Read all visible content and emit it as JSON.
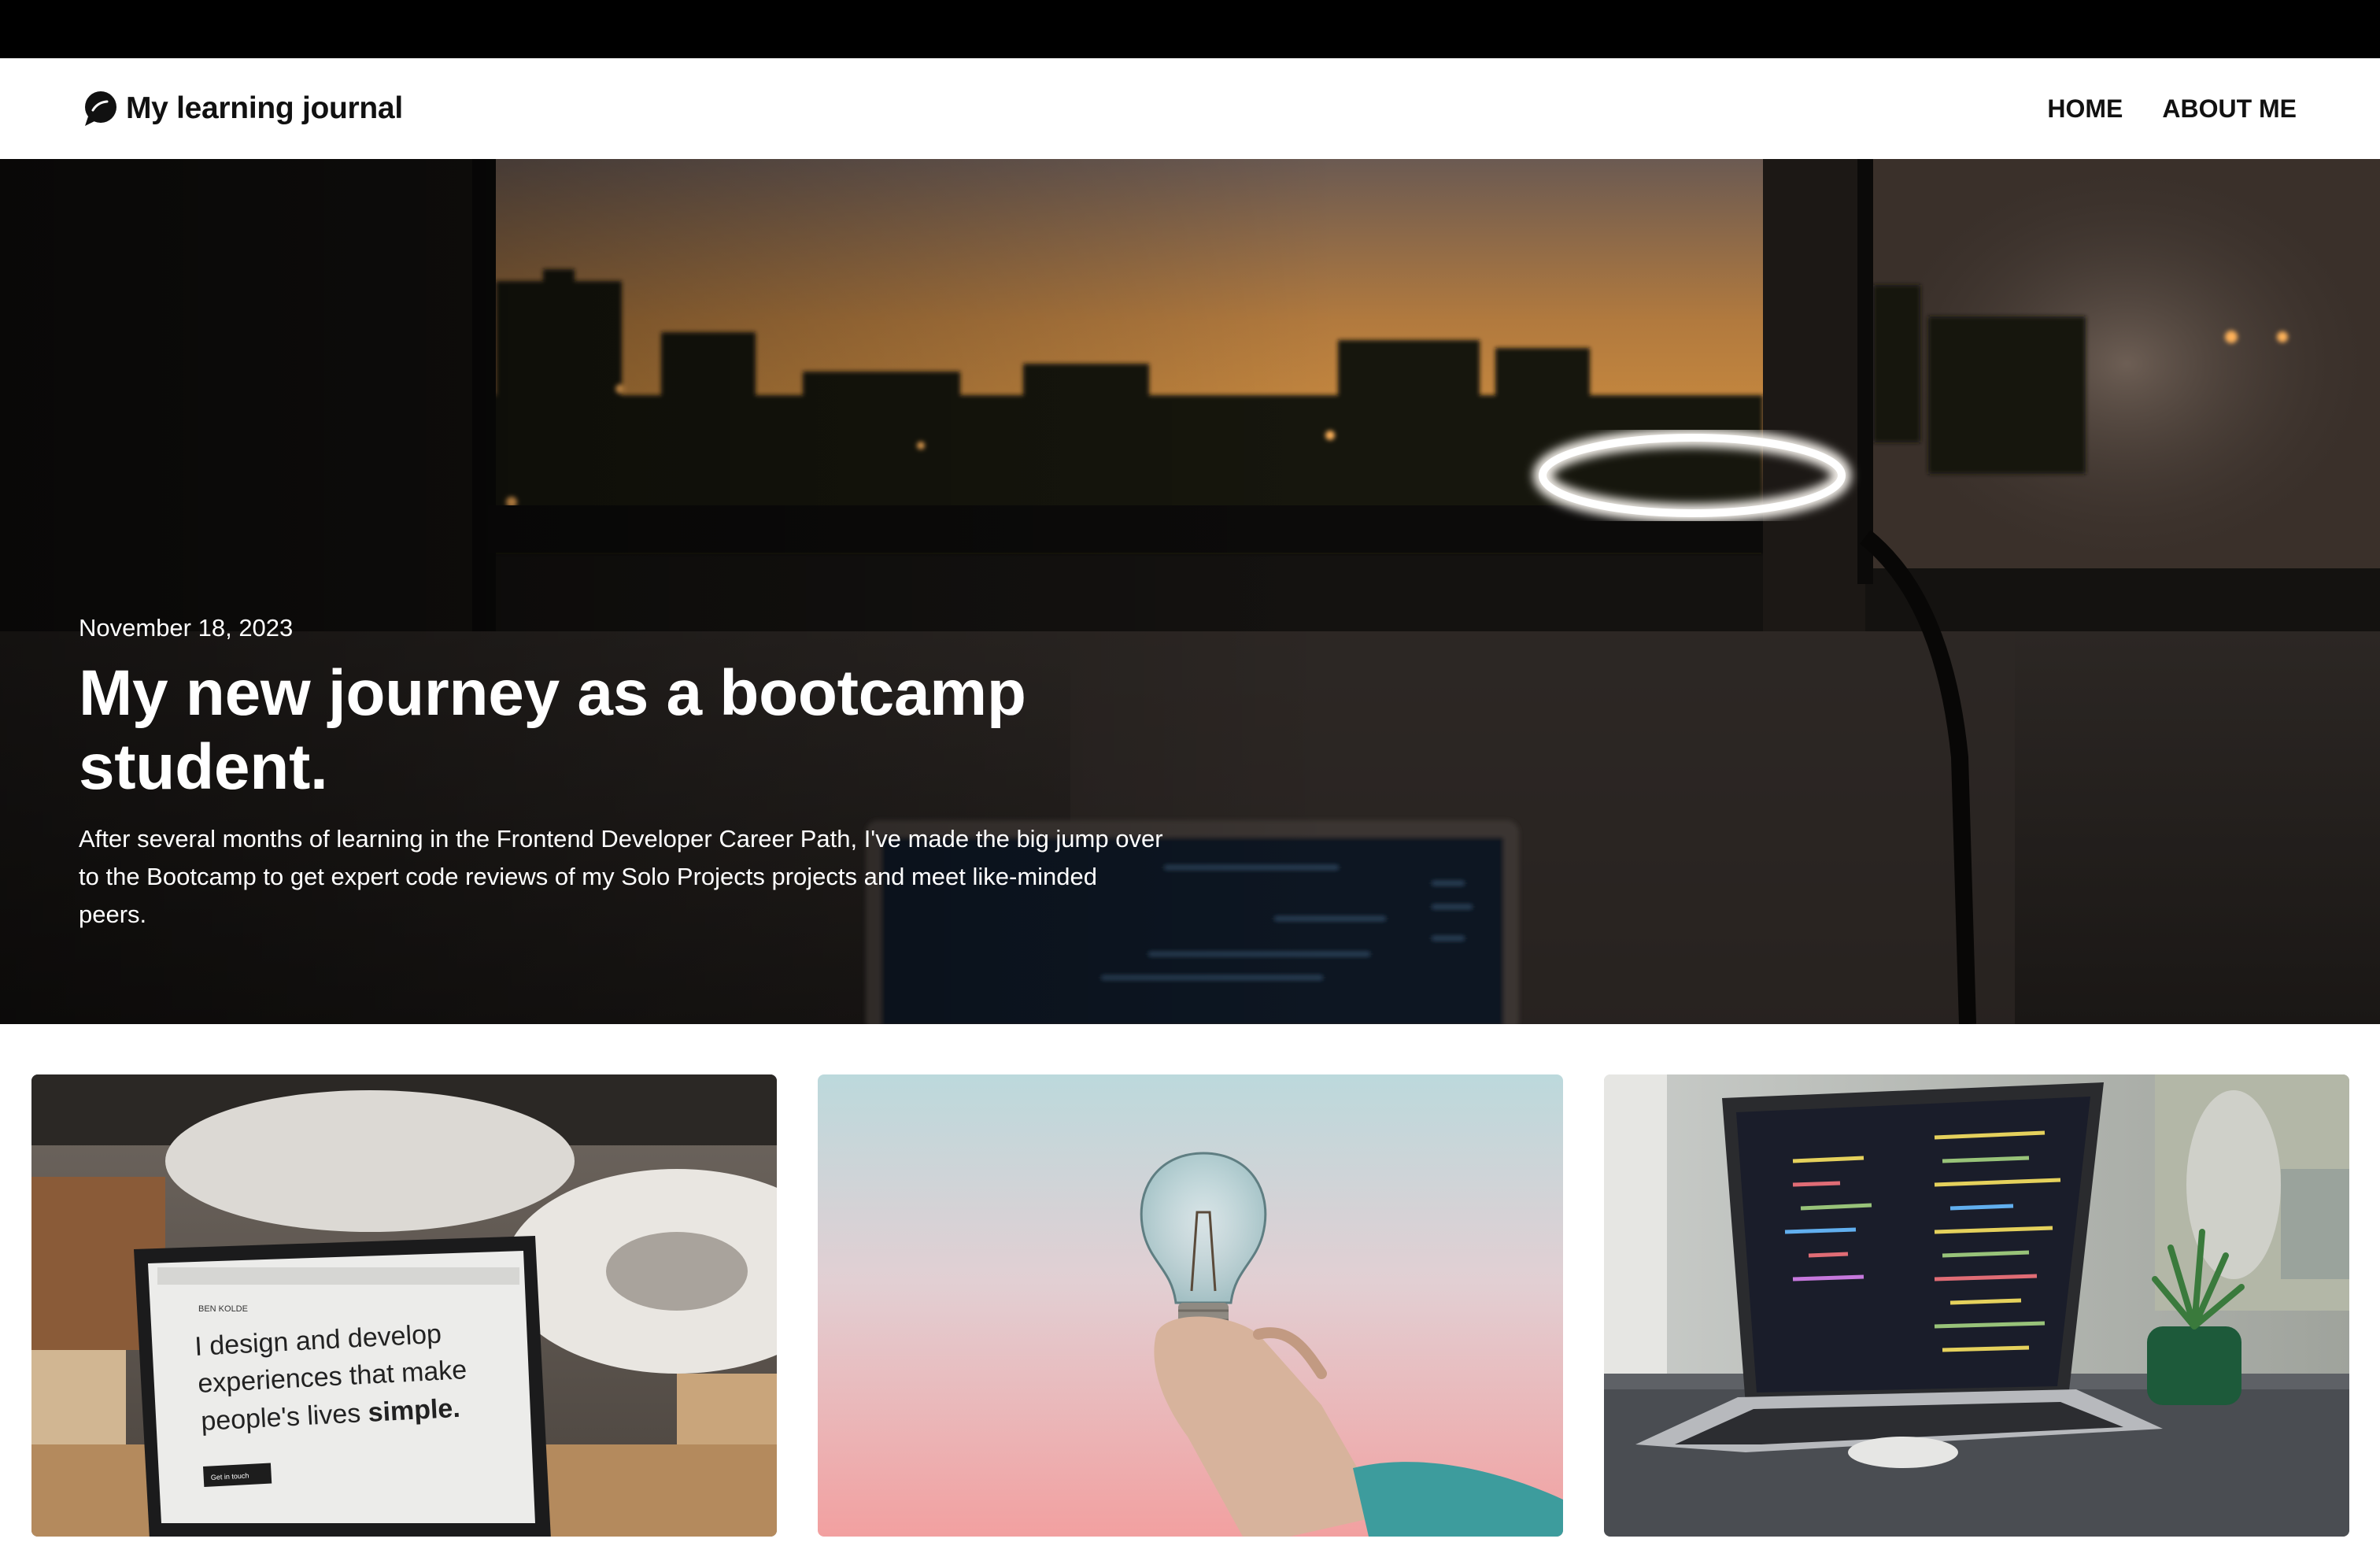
{
  "navbar": {
    "brand_title": "My learning journal",
    "brand_icon": "chat-bubble-icon",
    "links": [
      {
        "label": "HOME"
      },
      {
        "label": "ABOUT ME"
      }
    ]
  },
  "hero": {
    "date": "November 18, 2023",
    "title": "My new journey as a bootcamp student.",
    "excerpt": "After several months of learning in the Frontend Developer Career Path, I've made the big jump over to the Bootcamp to get expert code reviews of my Solo Projects projects and meet like-minded peers."
  },
  "cards": [
    {
      "image": "laptop-design-photo",
      "screen_text_line1": "I design and develop",
      "screen_text_line2": "experiences that make",
      "screen_text_line3_normal": "people's lives ",
      "screen_text_line3_bold": "simple.",
      "screen_header": "BEN KOLDE",
      "screen_button": "Get in touch"
    },
    {
      "image": "hand-holding-lightbulb-photo"
    },
    {
      "image": "laptop-code-photo"
    }
  ]
}
